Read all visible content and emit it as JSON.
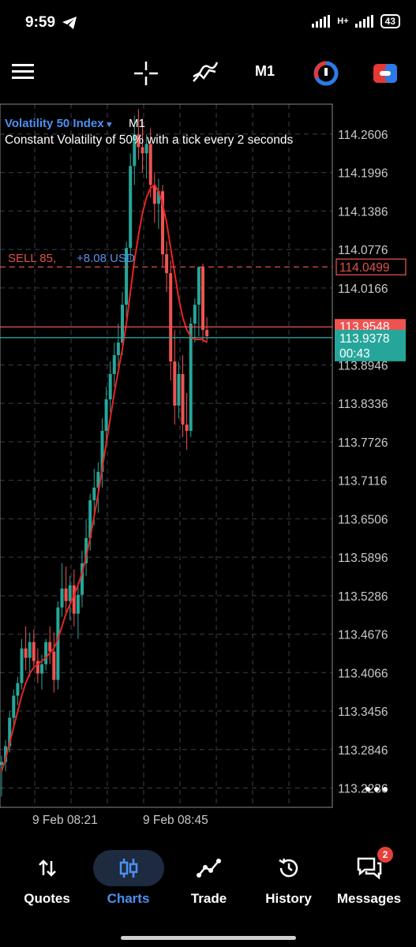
{
  "status": {
    "time": "9:59",
    "network": "H+",
    "battery": "43"
  },
  "toolbar": {
    "timeframe": "M1"
  },
  "chart": {
    "symbol": "Volatility 50 Index",
    "timeframe": "M1",
    "description": "Constant Volatility of 50% with a tick every 2 seconds",
    "position_label": "SELL 85,",
    "position_pnl": "+8.08 USD",
    "position_price": "114.0499",
    "ask_price": "113.9548",
    "bid_price": "113.9378",
    "countdown": "00:43"
  },
  "chart_data": {
    "type": "candlestick",
    "ylim": [
      113.193,
      114.308
    ],
    "y_ticks": [
      "114.2606",
      "114.1996",
      "114.1386",
      "114.0776",
      "114.0166",
      "113.8946",
      "113.8336",
      "113.7726",
      "113.7116",
      "113.6506",
      "113.5896",
      "113.5286",
      "113.4676",
      "113.4066",
      "113.3456",
      "113.2846",
      "113.2236"
    ],
    "x_ticks": [
      "9 Feb 08:21",
      "9 Feb 08:45"
    ],
    "colors": {
      "up": "#26a69a",
      "down": "#ef5350",
      "ma": "#e8241f"
    },
    "ohlc": [
      [
        113.26,
        113.275,
        113.21,
        113.265
      ],
      [
        113.265,
        113.3,
        113.25,
        113.29
      ],
      [
        113.29,
        113.345,
        113.28,
        113.335
      ],
      [
        113.335,
        113.38,
        113.32,
        113.37
      ],
      [
        113.37,
        113.4,
        113.355,
        113.39
      ],
      [
        113.39,
        113.46,
        113.38,
        113.445
      ],
      [
        113.445,
        113.48,
        113.41,
        113.43
      ],
      [
        113.43,
        113.47,
        113.4,
        113.455
      ],
      [
        113.455,
        113.475,
        113.415,
        113.425
      ],
      [
        113.425,
        113.445,
        113.39,
        113.405
      ],
      [
        113.405,
        113.435,
        113.38,
        113.42
      ],
      [
        113.42,
        113.46,
        113.41,
        113.455
      ],
      [
        113.455,
        113.48,
        113.42,
        113.44
      ],
      [
        113.44,
        113.47,
        113.375,
        113.395
      ],
      [
        113.395,
        113.52,
        113.38,
        113.51
      ],
      [
        113.51,
        113.58,
        113.495,
        113.54
      ],
      [
        113.54,
        113.575,
        113.5,
        113.52
      ],
      [
        113.52,
        113.56,
        113.49,
        113.545
      ],
      [
        113.545,
        113.57,
        113.48,
        113.5
      ],
      [
        113.5,
        113.55,
        113.46,
        113.53
      ],
      [
        113.53,
        113.6,
        113.51,
        113.58
      ],
      [
        113.58,
        113.65,
        113.56,
        113.62
      ],
      [
        113.62,
        113.69,
        113.6,
        113.68
      ],
      [
        113.68,
        113.73,
        113.64,
        113.7
      ],
      [
        113.7,
        113.74,
        113.66,
        113.725
      ],
      [
        113.725,
        113.81,
        113.7,
        113.79
      ],
      [
        113.79,
        113.86,
        113.77,
        113.84
      ],
      [
        113.84,
        113.9,
        113.82,
        113.88
      ],
      [
        113.88,
        113.93,
        113.86,
        113.91
      ],
      [
        113.91,
        113.96,
        113.88,
        113.93
      ],
      [
        113.93,
        114.01,
        113.91,
        113.99
      ],
      [
        113.99,
        114.09,
        113.97,
        114.08
      ],
      [
        114.08,
        114.23,
        114.06,
        114.21
      ],
      [
        114.21,
        114.29,
        114.18,
        114.26
      ],
      [
        114.26,
        114.3,
        114.22,
        114.24
      ],
      [
        114.24,
        114.285,
        114.2,
        114.23
      ],
      [
        114.23,
        114.26,
        114.19,
        114.245
      ],
      [
        114.245,
        114.27,
        114.16,
        114.18
      ],
      [
        114.18,
        114.2,
        114.12,
        114.15
      ],
      [
        114.15,
        114.19,
        114.11,
        114.17
      ],
      [
        114.17,
        114.18,
        114.05,
        114.07
      ],
      [
        114.07,
        114.09,
        114.01,
        114.04
      ],
      [
        114.04,
        114.06,
        113.87,
        113.9
      ],
      [
        113.9,
        113.95,
        113.8,
        113.83
      ],
      [
        113.83,
        113.9,
        113.81,
        113.88
      ],
      [
        113.88,
        113.91,
        113.78,
        113.8
      ],
      [
        113.8,
        113.85,
        113.76,
        113.79
      ],
      [
        113.79,
        113.97,
        113.78,
        113.96
      ],
      [
        113.96,
        114.0,
        113.93,
        113.99
      ],
      [
        113.99,
        114.05,
        113.94,
        114.05
      ],
      [
        114.05,
        114.055,
        113.93,
        113.95
      ],
      [
        113.95,
        113.97,
        113.93,
        113.94
      ]
    ],
    "ma": [
      113.25,
      113.27,
      113.295,
      113.32,
      113.345,
      113.37,
      113.39,
      113.405,
      113.415,
      113.42,
      113.425,
      113.43,
      113.438,
      113.445,
      113.46,
      113.48,
      113.5,
      113.515,
      113.53,
      113.545,
      113.565,
      113.59,
      113.62,
      113.655,
      113.69,
      113.73,
      113.77,
      113.81,
      113.85,
      113.885,
      113.92,
      113.96,
      114.01,
      114.06,
      114.1,
      114.135,
      114.16,
      114.175,
      114.18,
      114.17,
      114.15,
      114.12,
      114.08,
      114.04,
      114.0,
      113.97,
      113.95,
      113.94,
      113.935,
      113.935,
      113.935,
      113.93
    ]
  },
  "tabs": [
    {
      "label": "Quotes",
      "icon": "arrows-updown-icon"
    },
    {
      "label": "Charts",
      "icon": "candles-icon",
      "active": true
    },
    {
      "label": "Trade",
      "icon": "trend-line-icon"
    },
    {
      "label": "History",
      "icon": "history-icon"
    },
    {
      "label": "Messages",
      "icon": "messages-icon",
      "badge": "2"
    }
  ]
}
